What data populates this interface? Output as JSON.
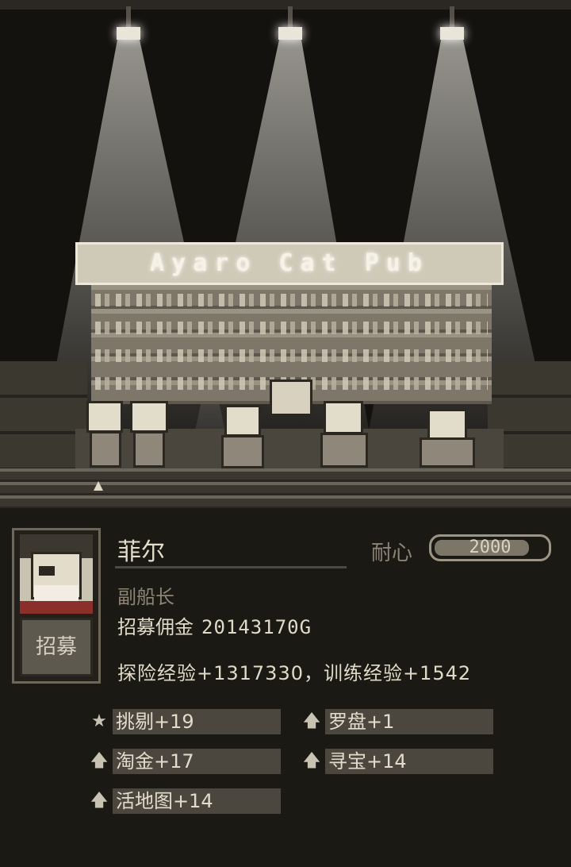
{
  "scene": {
    "sign_text": "Ayaro Cat Pub"
  },
  "character": {
    "name": "菲尔",
    "title": "副船长",
    "patience_label": "耐心",
    "patience_value": "2000",
    "patience_fraction": 0.85,
    "recruit_fee_label": "招募佣金",
    "recruit_fee_value": "20143170G",
    "exp_text": "探险经验+1317330，训练经验+1542",
    "recruit_button": "招募"
  },
  "skills": [
    {
      "icon": "star-icon",
      "label": "挑剔+19"
    },
    {
      "icon": "up-arrow-icon",
      "label": "罗盘+1"
    },
    {
      "icon": "up-arrow-icon",
      "label": "淘金+17"
    },
    {
      "icon": "up-arrow-icon",
      "label": "寻宝+14"
    },
    {
      "icon": "up-arrow-icon",
      "label": "活地图+14"
    }
  ],
  "colors": {
    "panel_bg": "#1b1914",
    "skill_bar": "#4b473f",
    "text": "#e2dccb",
    "muted": "#8c8576"
  }
}
